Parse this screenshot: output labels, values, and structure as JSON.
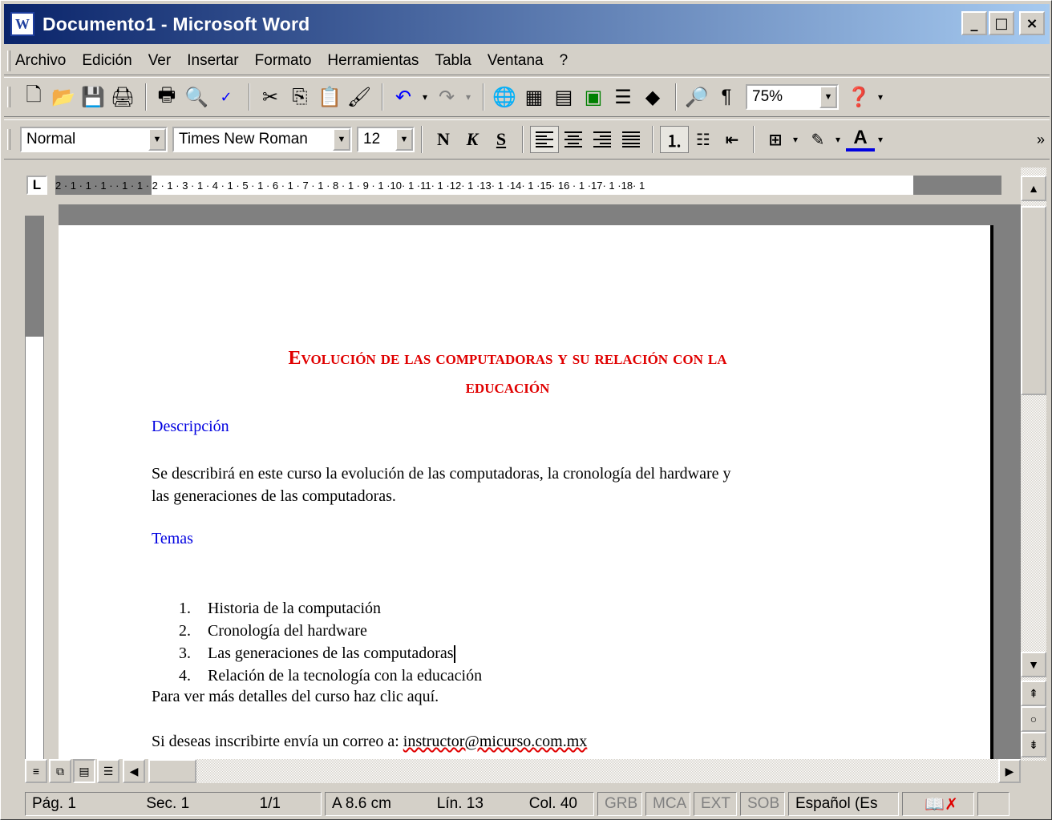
{
  "window": {
    "title": "Documento1 - Microsoft Word",
    "icon": "word-doc-icon",
    "min_label": "_",
    "max_label": "□",
    "close_label": "×"
  },
  "menu": [
    "Archivo",
    "Edición",
    "Ver",
    "Insertar",
    "Formato",
    "Herramientas",
    "Tabla",
    "Ventana",
    "?"
  ],
  "toolbar_standard": {
    "zoom": "75%"
  },
  "toolbar_format": {
    "style": "Normal",
    "font": "Times New Roman",
    "size": "12",
    "bold_label": "N",
    "italic_label": "K",
    "underline_label": "S"
  },
  "ruler": {
    "marks": "2 · 1 · 1 · 1 ·   · 1 · 1 · 2 · 1 · 3 · 1 · 4 · 1 · 5 · 1 · 6 · 1 · 7 · 1 · 8 · 1 · 9 · 1 ·10· 1 ·11· 1 ·12· 1 ·13· 1 ·14· 1 ·15·   16 · 1 ·17· 1 ·18· 1",
    "corner": "L"
  },
  "document": {
    "title_line1": "Evolución de las computadoras y su relación con la",
    "title_line2": "educación",
    "heading_description": "Descripción",
    "description_line1": "Se describirá en este curso la evolución de las computadoras, la cronología del hardware y",
    "description_line2": "las generaciones de las computadoras.",
    "heading_topics": "Temas",
    "topics": [
      {
        "num": "1.",
        "text": "Historia de la computación"
      },
      {
        "num": "2.",
        "text": "Cronología del hardware"
      },
      {
        "num": "3.",
        "text": "Las generaciones de las computadoras"
      },
      {
        "num": "4.",
        "text": "Relación de la tecnología con la educación"
      }
    ],
    "details": "Para ver más detalles del curso haz clic aquí.",
    "enroll_prefix": "Si deseas inscribirte envía un correo a: ",
    "email": "instructor@micurso.com.mx"
  },
  "status": {
    "page": "Pág. 1",
    "section": "Sec. 1",
    "pages": "1/1",
    "at": "A 8.6 cm",
    "line": "Lín. 13",
    "col": "Col. 40",
    "rec": "GRB",
    "trk": "MCA",
    "ext": "EXT",
    "ovr": "SOB",
    "lang": "Español (Es"
  },
  "colors": {
    "title_red": "#e00000",
    "heading_blue": "#0000e0",
    "titlebar_start": "#0a246a",
    "titlebar_end": "#a6caf0"
  }
}
